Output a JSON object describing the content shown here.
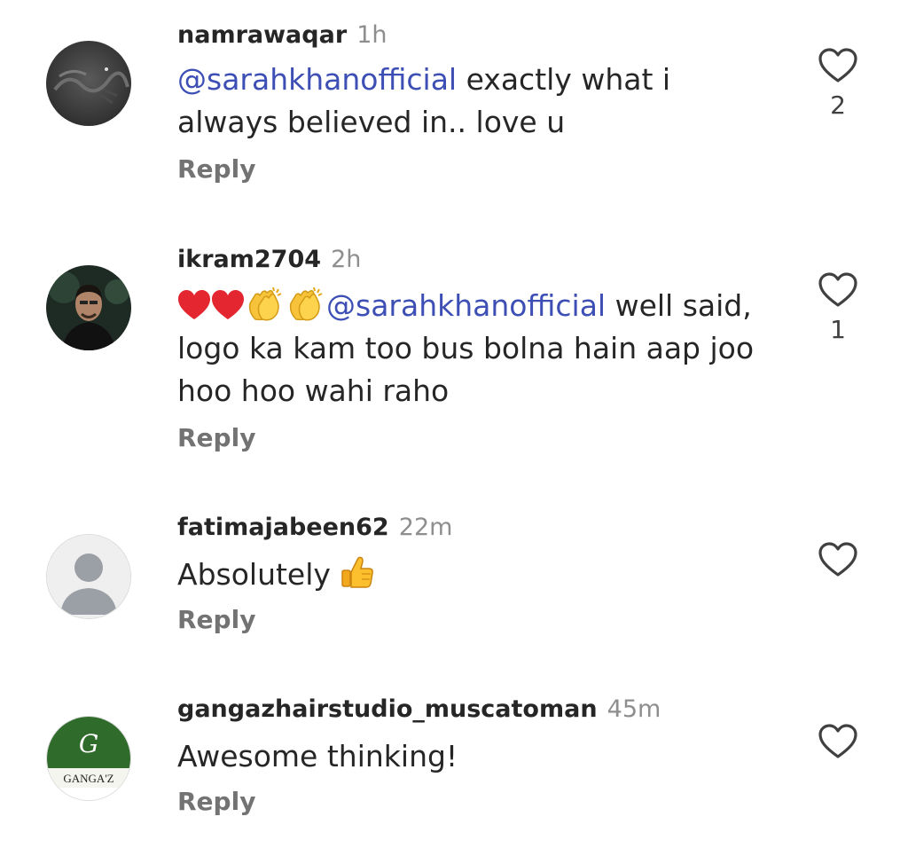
{
  "comments": [
    {
      "username": "namrawaqar",
      "time": "1h",
      "mention": "@sarahkhanofficial",
      "text": " exactly what i always believed in.. love u",
      "reply_label": "Reply",
      "likes": "2",
      "avatar": "dark-gray-photo"
    },
    {
      "username": "ikram2704",
      "time": "2h",
      "emojis": [
        "red-heart",
        "red-heart",
        "clapping-hands",
        "clapping-hands"
      ],
      "mention": "@sarahkhanofficial",
      "text": " well said, logo ka kam too bus bolna hain aap joo hoo hoo wahi raho",
      "reply_label": "Reply",
      "likes": "1",
      "avatar": "man-portrait-photo"
    },
    {
      "username": "fatimajabeen62",
      "time": "22m",
      "text": "Absolutely ",
      "emojis": [
        "thumbs-up"
      ],
      "reply_label": "Reply",
      "avatar": "default-person-silhouette"
    },
    {
      "username": "gangazhairstudio_muscatoman",
      "time": "45m",
      "text": "Awesome thinking!",
      "reply_label": "Reply",
      "avatar": "gangaz-logo",
      "avatar_logo_text": "GANGA'Z",
      "avatar_logo_monogram": "G"
    }
  ],
  "colors": {
    "mention": "#3d4fb5",
    "username": "#262626",
    "meta": "#8e8e8e",
    "reply": "#737373"
  }
}
